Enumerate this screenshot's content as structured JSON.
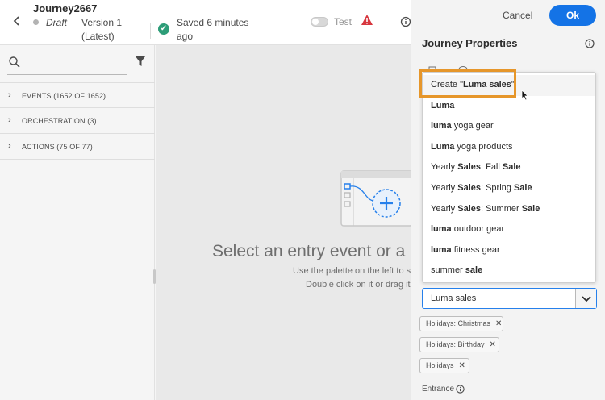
{
  "header": {
    "journey_name": "Journey2667",
    "status": "Draft",
    "version_line1": "Version 1",
    "version_line2": "(Latest)",
    "saved_line1": "Saved 6 minutes",
    "saved_line2": "ago",
    "test_label": "Test"
  },
  "palette": {
    "categories": [
      {
        "label": "EVENTS (1652 OF 1652)"
      },
      {
        "label": "ORCHESTRATION (3)"
      },
      {
        "label": "ACTIONS (75 OF 77)"
      }
    ]
  },
  "canvas": {
    "title": "Select an entry event or a re",
    "sub1": "Use the palette on the left to sele",
    "sub2": "Double click on it or drag it in"
  },
  "panel": {
    "cancel_label": "Cancel",
    "ok_label": "Ok",
    "title": "Journey Properties",
    "dropdown": {
      "create_prefix": "Create \"",
      "create_term": "Luma sales",
      "create_suffix": "\"",
      "options": [
        [
          {
            "t": "Luma",
            "b": true
          }
        ],
        [
          {
            "t": "luma",
            "b": true
          },
          {
            "t": " yoga gear",
            "b": false
          }
        ],
        [
          {
            "t": "Luma",
            "b": true
          },
          {
            "t": " yoga products",
            "b": false
          }
        ],
        [
          {
            "t": "Yearly ",
            "b": false
          },
          {
            "t": "Sales",
            "b": true
          },
          {
            "t": ": Fall ",
            "b": false
          },
          {
            "t": "Sale",
            "b": true
          }
        ],
        [
          {
            "t": "Yearly ",
            "b": false
          },
          {
            "t": "Sales",
            "b": true
          },
          {
            "t": ": Spring ",
            "b": false
          },
          {
            "t": "Sale",
            "b": true
          }
        ],
        [
          {
            "t": "Yearly ",
            "b": false
          },
          {
            "t": "Sales",
            "b": true
          },
          {
            "t": ": Summer ",
            "b": false
          },
          {
            "t": "Sale",
            "b": true
          }
        ],
        [
          {
            "t": "luma",
            "b": true
          },
          {
            "t": " outdoor gear",
            "b": false
          }
        ],
        [
          {
            "t": "luma",
            "b": true
          },
          {
            "t": " fitness gear",
            "b": false
          }
        ],
        [
          {
            "t": "summer ",
            "b": false
          },
          {
            "t": "sale",
            "b": true
          }
        ]
      ]
    },
    "tag_input_value": "Luma sales",
    "tags": [
      "Holidays: Christmas",
      "Holidays: Birthday",
      "Holidays"
    ],
    "entrance_label": "Entrance"
  },
  "colors": {
    "accent": "#1473e6",
    "highlight": "#e6962a",
    "success": "#2d9d78",
    "warning": "#d7373f"
  }
}
